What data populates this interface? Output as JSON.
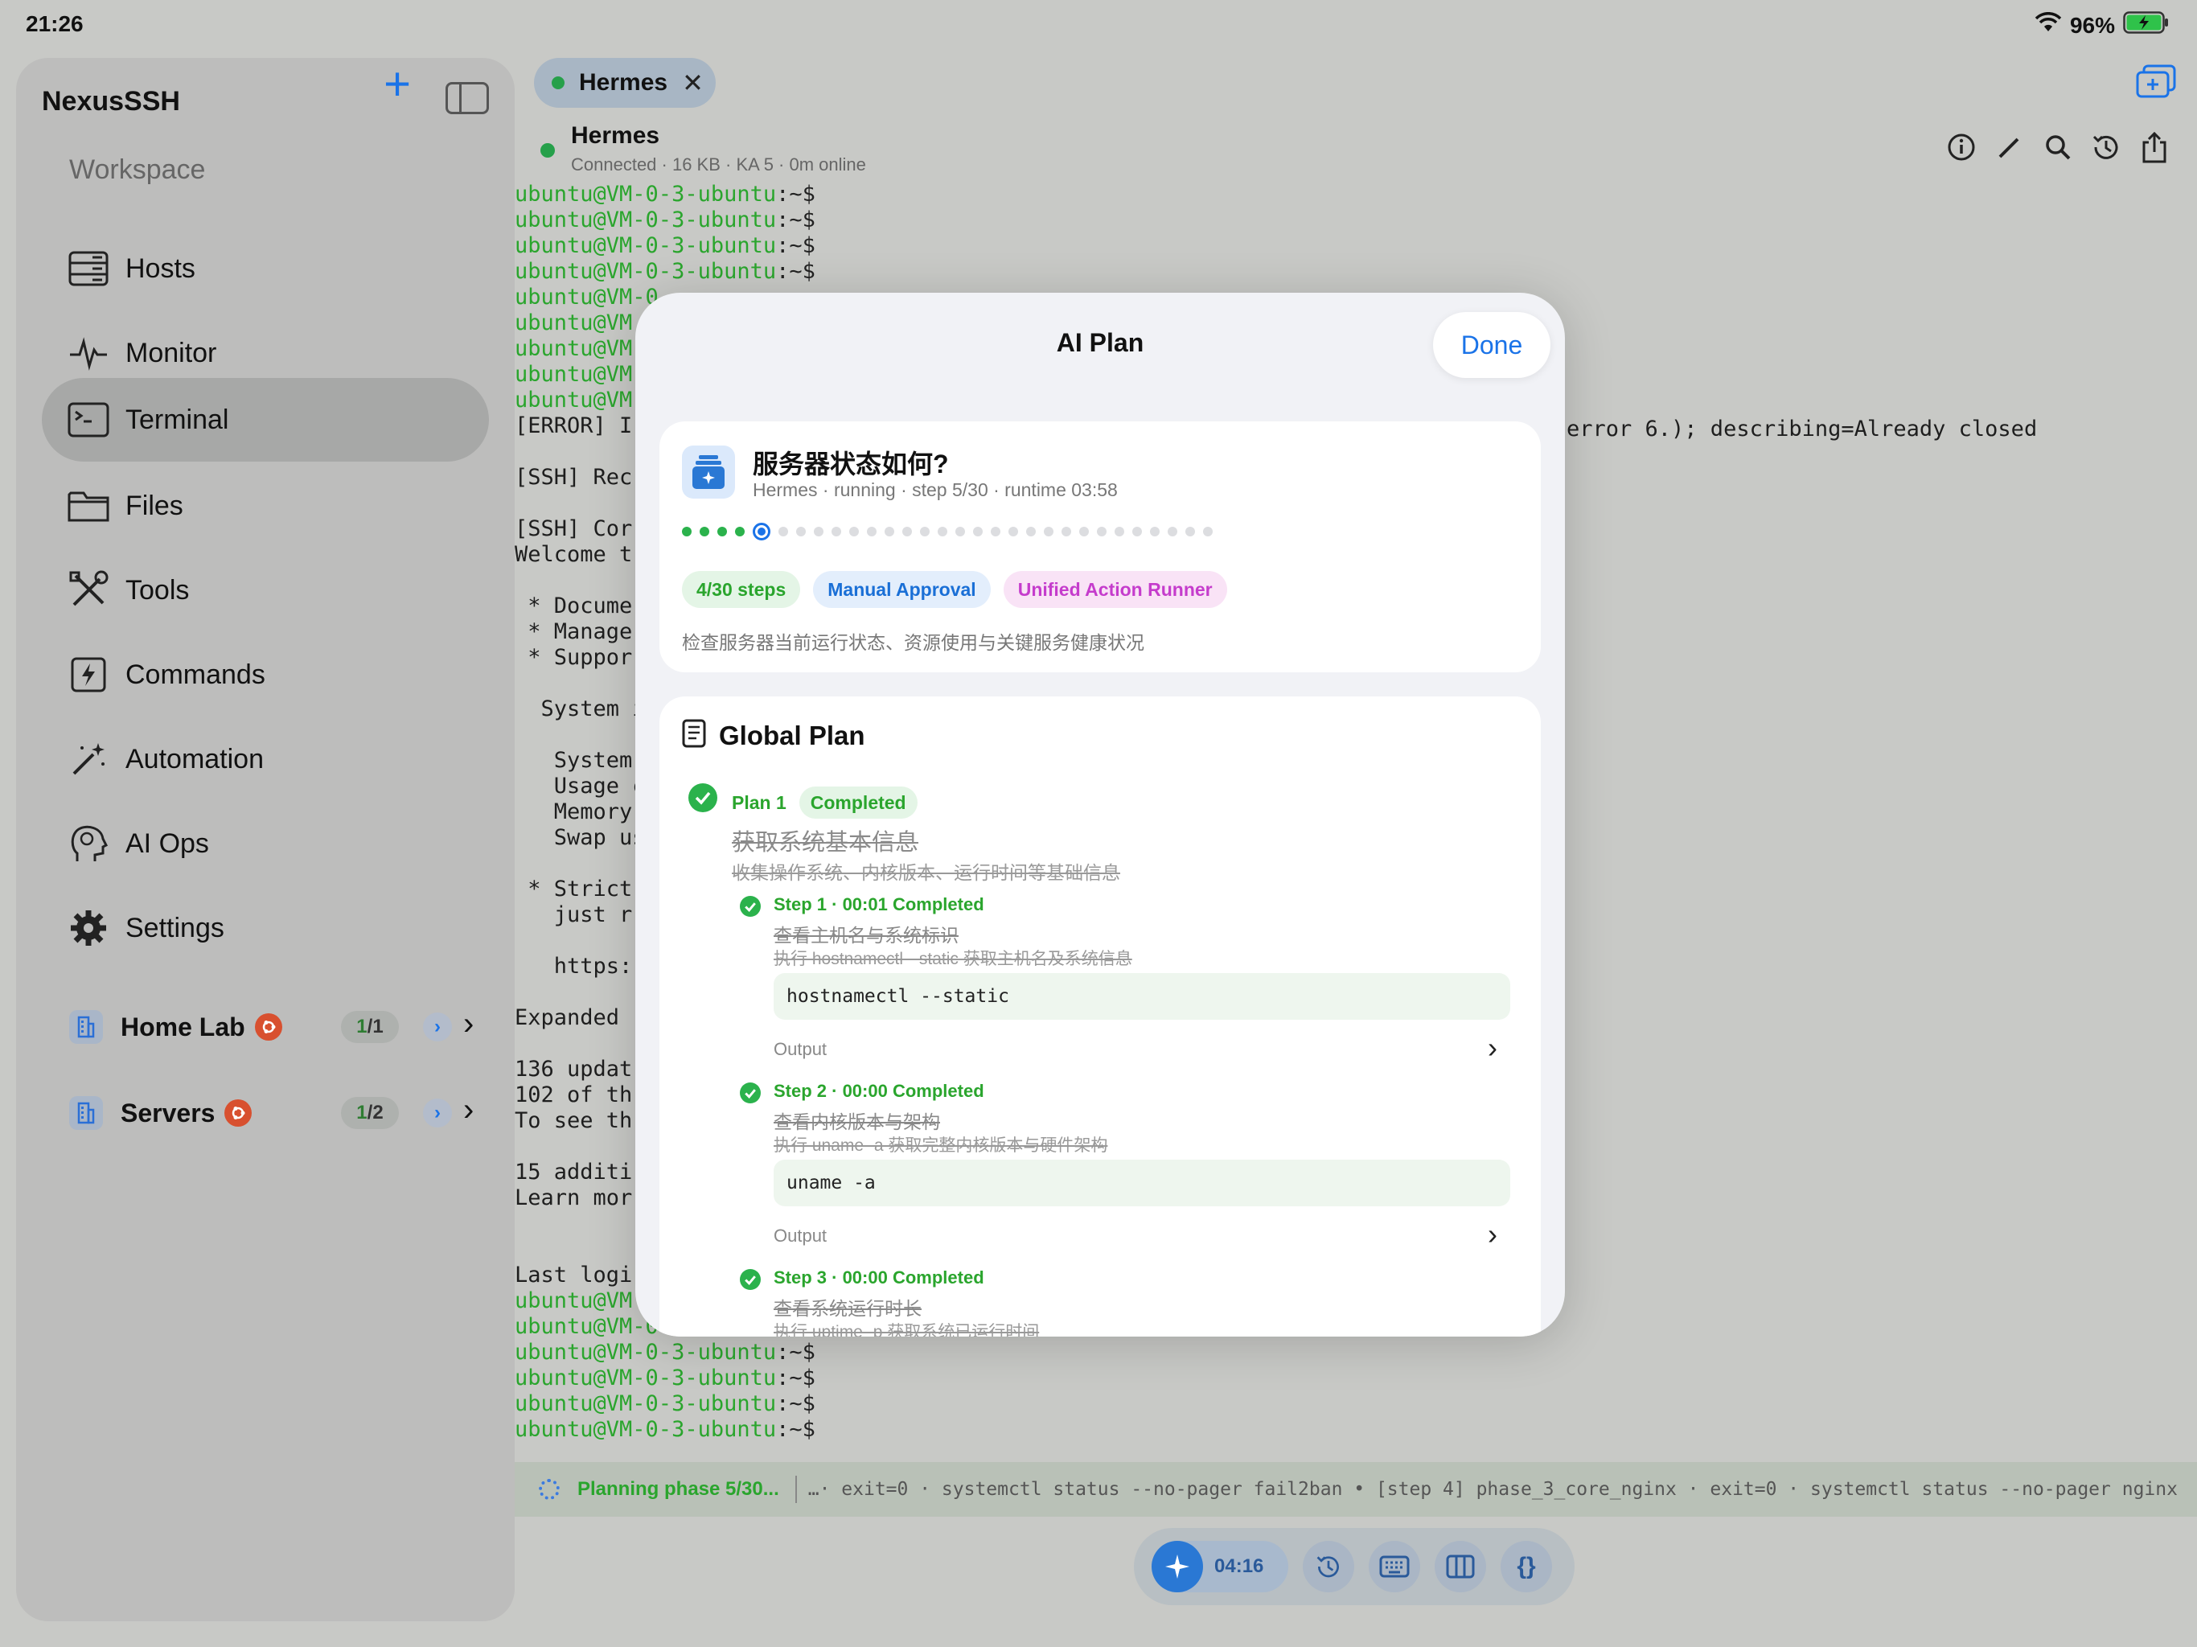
{
  "status_bar": {
    "time": "21:26",
    "battery": "96%"
  },
  "sidebar": {
    "title": "NexusSSH",
    "section": "Workspace",
    "items": [
      {
        "label": "Hosts",
        "icon": "server-icon"
      },
      {
        "label": "Monitor",
        "icon": "waveform-icon"
      },
      {
        "label": "Terminal",
        "icon": "terminal-icon",
        "active": true
      },
      {
        "label": "Files",
        "icon": "folder-icon"
      },
      {
        "label": "Tools",
        "icon": "tools-icon"
      },
      {
        "label": "Commands",
        "icon": "bolt-icon"
      },
      {
        "label": "Automation",
        "icon": "magic-wand-icon"
      },
      {
        "label": "AI Ops",
        "icon": "brain-head-icon"
      },
      {
        "label": "Settings",
        "icon": "gear-icon"
      }
    ],
    "groups": [
      {
        "name": "Home Lab",
        "count_online": "1",
        "count_sep": " / ",
        "count_total": "1"
      },
      {
        "name": "Servers",
        "count_online": "1",
        "count_sep": " / ",
        "count_total": "2"
      }
    ]
  },
  "tab": {
    "label": "Hermes"
  },
  "host": {
    "name": "Hermes",
    "meta": "Connected · 16 KB · KA 5 · 0m online"
  },
  "terminal": {
    "prompt_user": "ubuntu@VM-0-3-ubuntu",
    "prompt_suffix": ":~$",
    "lines_left": [
      "ubuntu@VM-0-3-ubuntu:~$",
      "ubuntu@VM-0-3-ubuntu:~$",
      "ubuntu@VM-0-3-ubuntu:~$",
      "ubuntu@VM-0-3-ubuntu:~$",
      "ubuntu@VM-0",
      "ubuntu@VM",
      "ubuntu@VM",
      "ubuntu@VM",
      "ubuntu@VM",
      "[ERROR] I",
      "",
      "[SSH] Rec",
      "",
      "[SSH] Cor",
      "Welcome t",
      "",
      " * Docume",
      " * Manage",
      " * Suppor",
      "",
      "  System i",
      "",
      "   System",
      "   Usage c",
      "   Memory",
      "   Swap us",
      "",
      " * Strict",
      "   just r",
      "",
      "   https:",
      "",
      "Expanded",
      "",
      "136 updat",
      "102 of th",
      "To see th",
      "",
      "15 additi",
      "Learn mor",
      "",
      "",
      "Last logi",
      "ubuntu@VM",
      "ubuntu@VM-0",
      "ubuntu@VM-0-3-ubuntu:~$",
      "ubuntu@VM-0-3-ubuntu:~$",
      "ubuntu@VM-0-3-ubuntu:~$",
      "ubuntu@VM-0-3-ubuntu:~$"
    ],
    "error_tail": "error 6.); describing=Already closed"
  },
  "status_line": {
    "phase": "Planning phase 5/30...",
    "log": "…· exit=0 · systemctl status --no-pager fail2ban  •  [step 4] phase_3_core_nginx · exit=0 · systemctl status --no-pager nginx"
  },
  "dock": {
    "timer": "04:16"
  },
  "modal": {
    "title": "AI Plan",
    "done": "Done",
    "task": {
      "title": "服务器状态如何?",
      "subtitle": "Hermes · running · step 5/30 · runtime 03:58",
      "progress": {
        "completed": 4,
        "current": 5,
        "total": 30
      },
      "chips": [
        "4/30 steps",
        "Manual Approval",
        "Unified Action Runner"
      ],
      "description": "检查服务器当前运行状态、资源使用与关键服务健康状况"
    },
    "global_plan": {
      "heading": "Global Plan",
      "plan_label": "Plan 1",
      "plan_status": "Completed",
      "plan_title": "获取系统基本信息",
      "plan_desc": "收集操作系统、内核版本、运行时间等基础信息",
      "steps": [
        {
          "header": "Step 1  · 00:01  Completed",
          "title": "查看主机名与系统标识",
          "desc": "执行 hostnamectl --static 获取主机名及系统信息",
          "cmd": "hostnamectl --static",
          "output_label": "Output"
        },
        {
          "header": "Step 2  · 00:00  Completed",
          "title": "查看内核版本与架构",
          "desc": "执行 uname -a 获取完整内核版本与硬件架构",
          "cmd": "uname -a",
          "output_label": "Output"
        },
        {
          "header": "Step 3  · 00:00  Completed",
          "title": "查看系统运行时长",
          "desc": "执行 uptime -p 获取系统已运行时间"
        }
      ]
    }
  },
  "colors": {
    "accent": "#1a73e8",
    "success": "#2bb24c",
    "prompt": "#2aa52d"
  }
}
